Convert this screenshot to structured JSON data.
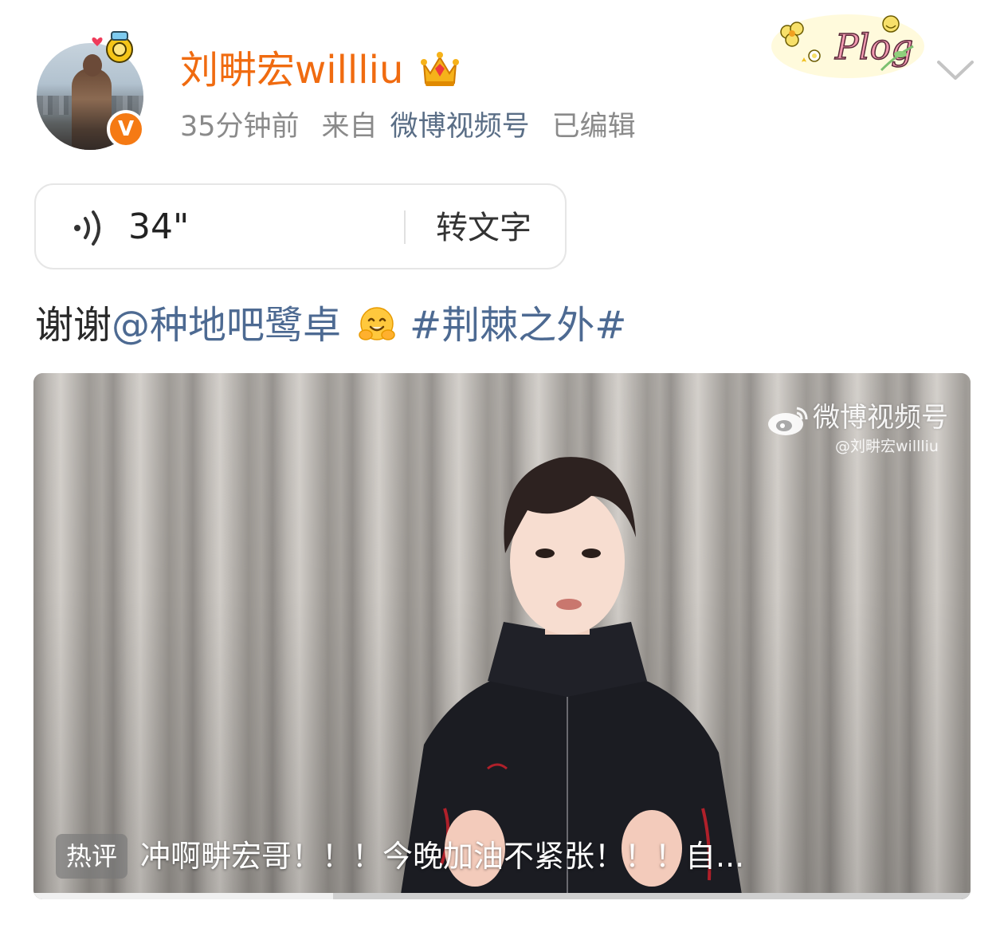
{
  "header": {
    "username": "刘畊宏willliu",
    "time": "35分钟前",
    "source_prefix": "来自",
    "source": "微博视频号",
    "edited": "已编辑",
    "verified_mark": "V",
    "sticker_icon": "plog-sticker-icon",
    "menu_icon": "chevron-down-icon"
  },
  "voice": {
    "duration": "34\"",
    "convert_label": "转文字",
    "icon": "voice-wave-icon"
  },
  "post": {
    "thanks": "谢谢",
    "mention": "@种地吧鹭卓",
    "topic": "#荆棘之外#",
    "emoji": "hugging-face-emoji"
  },
  "video": {
    "watermark_title": "微博视频号",
    "watermark_handle": "@刘畊宏willliu",
    "hot_tag": "热评",
    "hot_comment": "冲啊畊宏哥！！！今晚加油不紧张！！！自...",
    "progress": 0.32
  },
  "colors": {
    "username": "#f06b10",
    "link": "#4d6a92",
    "meta": "#8a8a8a",
    "badge": "#f57a14"
  }
}
